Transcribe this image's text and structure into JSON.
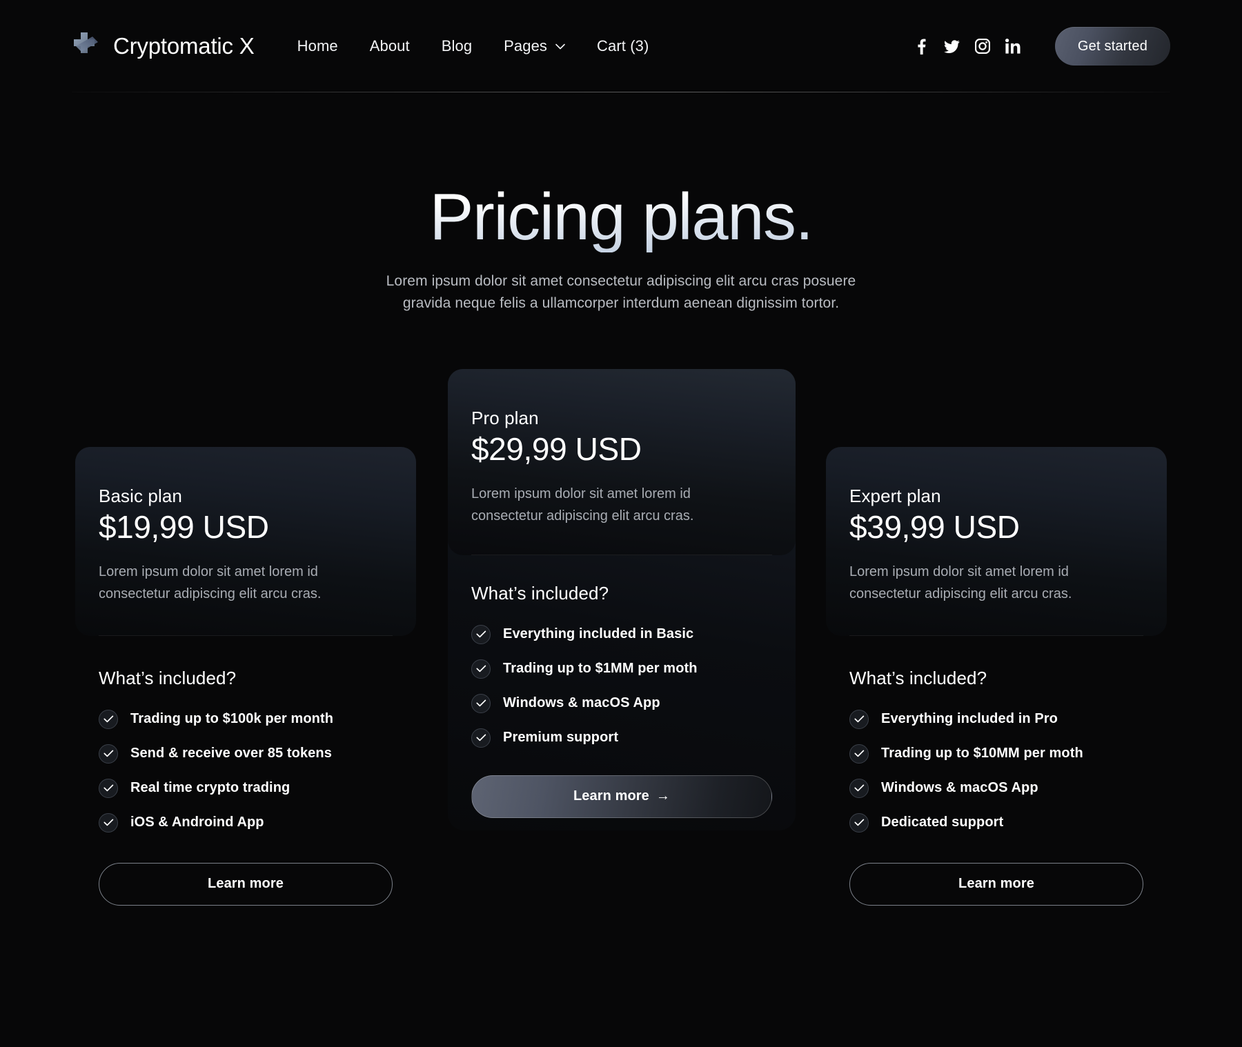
{
  "brand": {
    "name": "Cryptomatic X",
    "logo_icon": "cryptomatic-logo-icon"
  },
  "nav": {
    "items": [
      {
        "label": "Home"
      },
      {
        "label": "About"
      },
      {
        "label": "Blog"
      },
      {
        "label": "Pages",
        "has_dropdown": true,
        "dropdown_icon": "chevron-down-icon"
      },
      {
        "label": "Cart (3)"
      }
    ]
  },
  "social": [
    {
      "name": "facebook-icon"
    },
    {
      "name": "twitter-icon"
    },
    {
      "name": "instagram-icon"
    },
    {
      "name": "linkedin-icon"
    }
  ],
  "header": {
    "cta_label": "Get started"
  },
  "hero": {
    "title": "Pricing plans.",
    "subtitle_line1": "Lorem ipsum dolor sit amet consectetur adipiscing elit arcu cras posuere",
    "subtitle_line2": "gravida neque felis a ullamcorper interdum aenean dignissim tortor."
  },
  "colors": {
    "page_background": "#070708",
    "card_gradient_top": "#1e232d",
    "card_gradient_bottom": "#08090b",
    "accent_button": "#5a6070",
    "body_text": "#a8acb3",
    "heading_text": "#ffffff",
    "divider": "rgba(255,255,255,0.30)"
  },
  "plans": [
    {
      "id": "basic",
      "name": "Basic plan",
      "price": "$19,99 USD",
      "description": "Lorem ipsum dolor sit amet lorem id consectetur adipiscing elit arcu cras.",
      "included_title": "What’s included?",
      "features": [
        "Trading up to $100k per month",
        "Send & receive over 85 tokens",
        "Real time crypto trading",
        "iOS & Androind App"
      ],
      "cta_label": "Learn more",
      "featured": false
    },
    {
      "id": "pro",
      "name": "Pro plan",
      "price": "$29,99 USD",
      "description": "Lorem ipsum dolor sit amet lorem id consectetur adipiscing elit arcu cras.",
      "included_title": "What’s included?",
      "features": [
        "Everything included in Basic",
        "Trading up to $1MM per moth",
        "Windows & macOS App",
        "Premium support"
      ],
      "cta_label": "Learn more",
      "cta_arrow": "→",
      "featured": true
    },
    {
      "id": "expert",
      "name": "Expert plan",
      "price": "$39,99 USD",
      "description": "Lorem ipsum dolor sit amet lorem id consectetur adipiscing elit arcu cras.",
      "included_title": "What’s included?",
      "features": [
        "Everything included in Pro",
        "Trading up to $10MM per moth",
        "Windows & macOS App",
        "Dedicated support"
      ],
      "cta_label": "Learn more",
      "featured": false
    }
  ]
}
